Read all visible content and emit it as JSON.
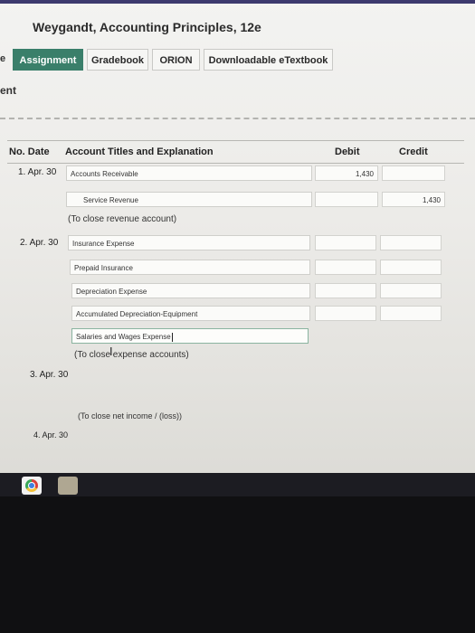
{
  "header": {
    "book_title": "Weygandt, Accounting Principles, 12e"
  },
  "tabs": {
    "left_stub": "e",
    "items": [
      {
        "label": "Assignment"
      },
      {
        "label": "Gradebook"
      },
      {
        "label": "ORION"
      },
      {
        "label": "Downloadable eTextbook"
      }
    ]
  },
  "section_stub": "ent",
  "table": {
    "headers": {
      "no_date": "No. Date",
      "account": "Account Titles and Explanation",
      "debit": "Debit",
      "credit": "Credit"
    },
    "entry1": {
      "label": "1. Apr. 30",
      "line1_account": "Accounts Receivable",
      "line1_debit": "1,430",
      "line1_credit": "",
      "line2_account": "Service Revenue",
      "line2_debit": "",
      "line2_credit": "1,430",
      "explanation": "(To close revenue account)"
    },
    "entry2": {
      "label": "2. Apr. 30",
      "line1_account": "Insurance Expense",
      "line2_account": "Prepaid Insurance",
      "line3_account": "Depreciation Expense",
      "line4_account": "Accumulated Depreciation-Equipment",
      "line5_account": "Salaries and Wages Expense",
      "explanation": "(To close expense accounts)"
    },
    "entry3": {
      "label": "3. Apr. 30",
      "explanation": "(To close net income / (loss))"
    },
    "entry4": {
      "label": "4. Apr. 30"
    }
  },
  "taskbar": {
    "icons": [
      "chrome-icon",
      "app-icon"
    ]
  }
}
